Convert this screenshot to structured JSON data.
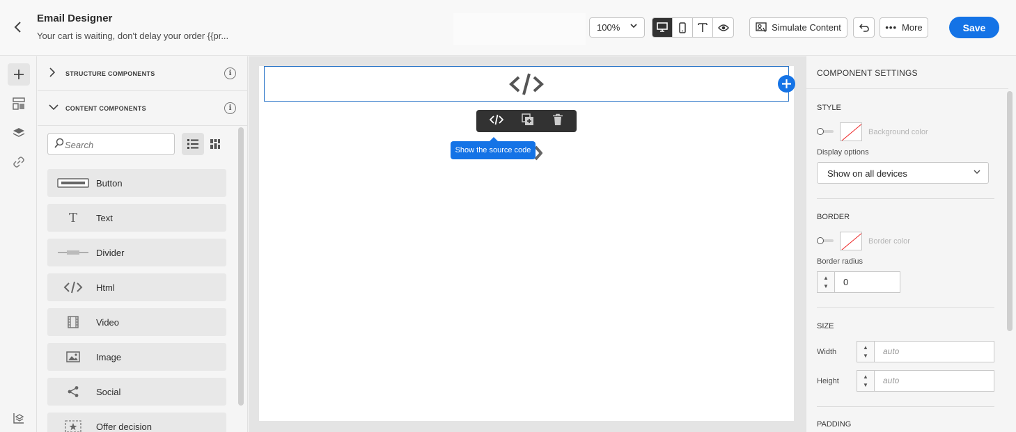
{
  "header": {
    "title": "Email Designer",
    "subtitle": "Your cart is waiting, don't delay your order {{pr...",
    "zoom": "100%",
    "simulate_label": "Simulate Content",
    "more_label": "More",
    "save_label": "Save",
    "device_buttons": [
      "desktop-icon",
      "mobile-icon",
      "text-icon",
      "eye-icon"
    ]
  },
  "rail": {
    "items": [
      "plus-icon",
      "layout-icon",
      "layers-icon",
      "link-icon",
      "assets-icon"
    ]
  },
  "panel": {
    "structure_label": "STRUCTURE COMPONENTS",
    "content_label": "CONTENT COMPONENTS",
    "search_placeholder": "Search",
    "components": [
      {
        "label": "Button",
        "icon": "button-icon"
      },
      {
        "label": "Text",
        "icon": "text-icon"
      },
      {
        "label": "Divider",
        "icon": "divider-icon"
      },
      {
        "label": "Html",
        "icon": "code-icon"
      },
      {
        "label": "Video",
        "icon": "film-icon"
      },
      {
        "label": "Image",
        "icon": "image-icon"
      },
      {
        "label": "Social",
        "icon": "share-icon"
      },
      {
        "label": "Offer decision",
        "icon": "offer-icon"
      }
    ]
  },
  "canvas": {
    "tooltip": "Show the source code",
    "html_glyph": "</>"
  },
  "settings": {
    "title": "COMPONENT SETTINGS",
    "style_title": "STYLE",
    "background_color_label": "Background color",
    "display_options_label": "Display options",
    "display_options_value": "Show on all devices",
    "border_title": "BORDER",
    "border_color_label": "Border color",
    "border_radius_label": "Border radius",
    "border_radius_value": "0",
    "size_title": "SIZE",
    "width_label": "Width",
    "width_placeholder": "auto",
    "height_label": "Height",
    "height_placeholder": "auto",
    "padding_title": "PADDING"
  },
  "colors": {
    "accent": "#1473e6",
    "toolbar": "#323232",
    "selection_border": "#2b75c8"
  }
}
